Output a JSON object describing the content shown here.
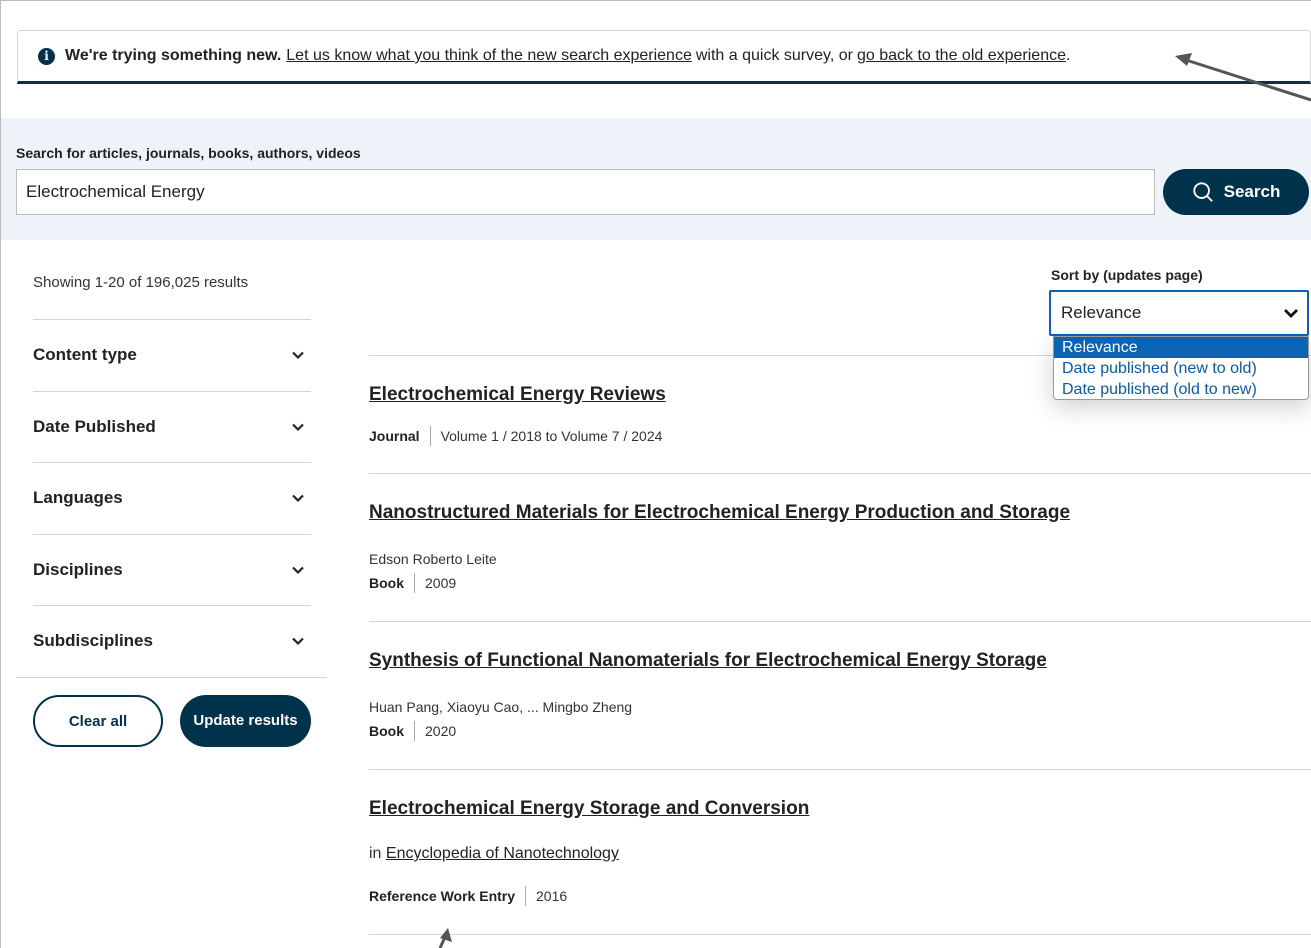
{
  "banner": {
    "bold": "We're trying something new.",
    "link1": "Let us know what you think of the new search experience",
    "mid": "with a quick survey, or",
    "link2": "go back to the old experience",
    "end": "."
  },
  "search": {
    "label": "Search for articles, journals, books, authors, videos",
    "value": "Electrochemical Energy",
    "button": "Search"
  },
  "sidebar": {
    "showing": "Showing 1-20 of 196,025 results",
    "filters": [
      "Content type",
      "Date Published",
      "Languages",
      "Disciplines",
      "Subdisciplines"
    ],
    "clear": "Clear all",
    "update": "Update results"
  },
  "sort": {
    "label": "Sort by (updates page)",
    "selected": "Relevance",
    "options": [
      "Relevance",
      "Date published (new to old)",
      "Date published (old to new)"
    ]
  },
  "results": [
    {
      "title": "Electrochemical Energy Reviews",
      "type": "Journal",
      "detail": "Volume 1 / 2018 to Volume 7 / 2024"
    },
    {
      "title": "Nanostructured Materials for Electrochemical Energy Production and Storage",
      "authors": "Edson Roberto Leite",
      "type": "Book",
      "detail": "2009"
    },
    {
      "title": "Synthesis of Functional Nanomaterials for Electrochemical Energy Storage",
      "authors": "Huan Pang, Xiaoyu Cao, ... Mingbo Zheng",
      "type": "Book",
      "detail": "2020"
    },
    {
      "title": "Electrochemical Energy Storage and Conversion",
      "in_prefix": "in",
      "in_ref": "Encyclopedia of Nanotechnology",
      "type": "Reference Work Entry",
      "detail": "2016"
    }
  ],
  "colors": {
    "brand": "#01324b",
    "accent": "#0b63b6",
    "band": "#eef3f9"
  }
}
